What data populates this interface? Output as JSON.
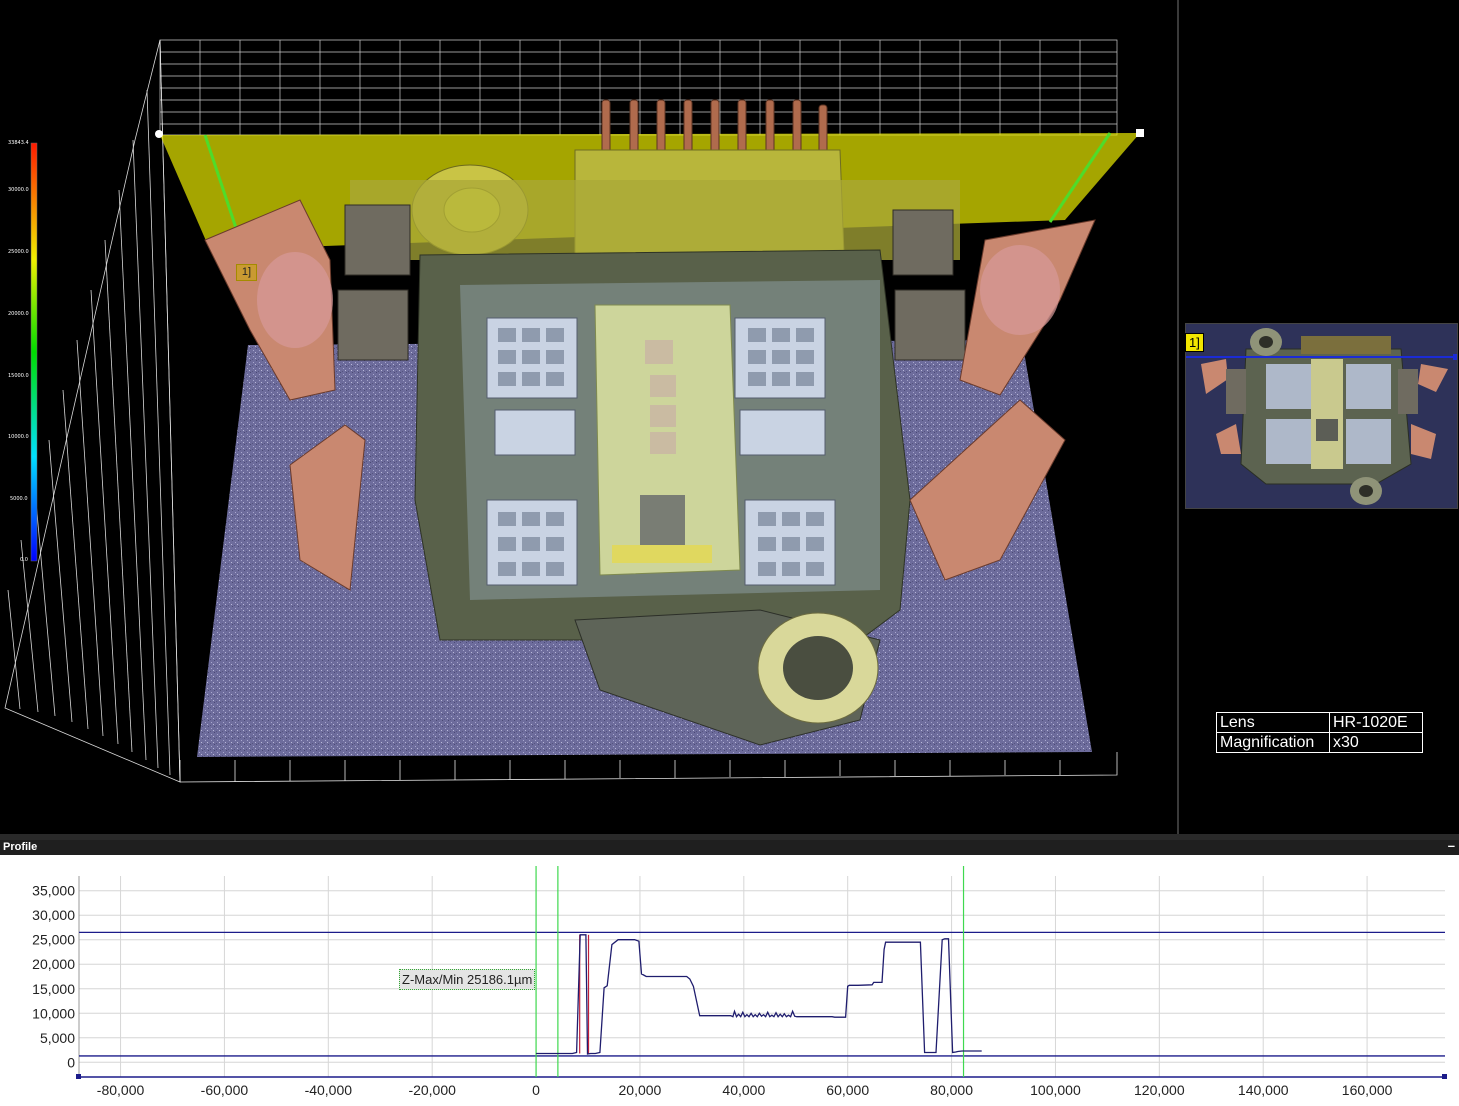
{
  "colors": {
    "grid_3d": "#ffffff",
    "plane_yellow": "#f0f000",
    "profile_line": "#1f1d6e",
    "cursor_green": "#3fd94f",
    "baseline_blue": "#1b1b8a",
    "red_mark": "#c0203a"
  },
  "view3d": {
    "marker_label": "1]",
    "colorbar_ticks": [
      "33843.4",
      "30000.0",
      "25000.0",
      "20000.0",
      "15000.0",
      "10000.0",
      "5000.0",
      "0.0"
    ]
  },
  "thumbnail": {
    "marker_label": "1]"
  },
  "lens_info": {
    "rows": [
      {
        "key": "Lens",
        "value": "HR-1020E"
      },
      {
        "key": "Magnification",
        "value": "x30"
      }
    ]
  },
  "profile": {
    "title": "Profile",
    "minimize_glyph": "–",
    "annotation": "Z-Max/Min 25186.1µm"
  },
  "chart_data": {
    "type": "line",
    "title": "",
    "xlabel": "",
    "ylabel": "",
    "xlim": [
      -88000,
      175000
    ],
    "ylim": [
      -3000,
      38000
    ],
    "x_ticks": [
      "-80,000",
      "-60,000",
      "-40,000",
      "-20,000",
      "0",
      "20,000",
      "40,000",
      "60,000",
      "80,000",
      "100,000",
      "120,000",
      "140,000",
      "160,000"
    ],
    "x_tick_values": [
      -80000,
      -60000,
      -40000,
      -20000,
      0,
      20000,
      40000,
      60000,
      80000,
      100000,
      120000,
      140000,
      160000
    ],
    "y_ticks": [
      "35,000",
      "30,000",
      "25,000",
      "20,000",
      "15,000",
      "10,000",
      "5,000",
      "0"
    ],
    "y_tick_values": [
      35000,
      30000,
      25000,
      20000,
      15000,
      10000,
      5000,
      0
    ],
    "reference_lines_y": [
      26500,
      1300
    ],
    "cursor_lines_x": [
      0,
      4200,
      82300
    ],
    "grid": true,
    "series": [
      {
        "x": [
          0,
          3000,
          6500,
          7000,
          7800,
          8500,
          9600,
          9900,
          10500,
          11400,
          12300,
          13100,
          13700,
          14600,
          15800,
          19000,
          19800,
          20300,
          20700,
          21200,
          29000,
          29600,
          30300,
          31500,
          37500,
          37900,
          38200,
          38600,
          39000,
          39400,
          39800,
          40200,
          40600,
          41000,
          41400,
          41800,
          42200,
          42600,
          43000,
          43400,
          43800,
          44200,
          44600,
          45000,
          45400,
          45800,
          46200,
          46600,
          47000,
          47400,
          47800,
          48200,
          48600,
          49000,
          49400,
          49800,
          50200,
          50600,
          51000,
          51400,
          51800,
          52200,
          52600,
          53000,
          53400,
          53800,
          54200,
          54600,
          55000,
          55400,
          55800,
          56200,
          56600,
          57000,
          57500,
          58500,
          59000,
          59300,
          59600,
          60000,
          60300,
          62000,
          64700,
          65000,
          66600,
          67000,
          67300,
          67500,
          69500,
          70300,
          71000,
          72000,
          73000,
          74000,
          74800,
          75200,
          76000,
          77000,
          78200,
          78700,
          79400,
          80200,
          80800,
          81200,
          82000,
          85800
        ],
        "y": [
          1800,
          1800,
          1800,
          1800,
          2000,
          26000,
          26000,
          1700,
          1800,
          1800,
          2000,
          15200,
          15600,
          24000,
          25000,
          25000,
          24700,
          18000,
          17800,
          17500,
          17500,
          17000,
          15500,
          9500,
          9500,
          9300,
          10400,
          9300,
          9800,
          9300,
          10200,
          9300,
          9700,
          9300,
          10000,
          9300,
          9700,
          9300,
          10000,
          9400,
          9700,
          9300,
          10200,
          9300,
          9600,
          9300,
          10100,
          9300,
          9800,
          9300,
          9900,
          9300,
          9600,
          9300,
          10400,
          9400,
          9300,
          9300,
          9300,
          9300,
          9300,
          9300,
          9300,
          9300,
          9300,
          9300,
          9300,
          9300,
          9300,
          9300,
          9300,
          9300,
          9300,
          9300,
          9200,
          9200,
          9200,
          9200,
          9200,
          15500,
          15700,
          15700,
          15800,
          16300,
          16300,
          23000,
          24500,
          24500,
          24500,
          24500,
          24500,
          24500,
          24500,
          24500,
          2000,
          2000,
          2000,
          2000,
          25000,
          25200,
          25200,
          2000,
          2100,
          2200,
          2300,
          2300
        ]
      }
    ]
  }
}
